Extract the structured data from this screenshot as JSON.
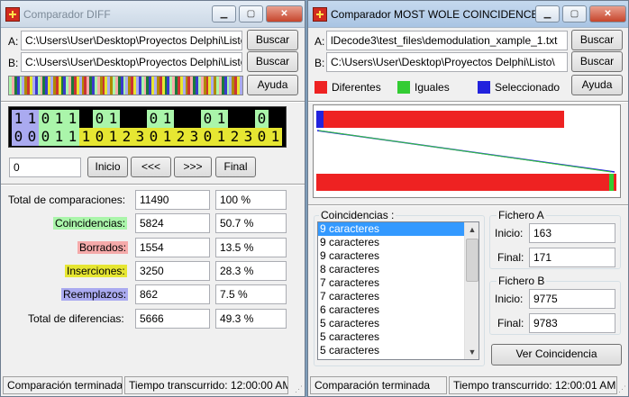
{
  "left": {
    "title": "Comparador DIFF",
    "label_a": "A:",
    "label_b": "B:",
    "path_a": "C:\\Users\\User\\Desktop\\Proyectos Delphi\\Listo",
    "path_b": "C:\\Users\\User\\Desktop\\Proyectos Delphi\\Listo",
    "buscar_a": "Buscar",
    "buscar_b": "Buscar",
    "ayuda": "Ayuda",
    "diff_row1": "11011 01  01  01  0",
    "diff_row2": "00011101230123012301",
    "position_value": "0",
    "nav": {
      "inicio": "Inicio",
      "prev": "<<<",
      "next": ">>>",
      "final": "Final"
    },
    "stats": {
      "total_label": "Total de comparaciones:",
      "total_value": "11490",
      "total_pct": "100 %",
      "coincidencias_label": "Coincidencias:",
      "coincidencias_value": "5824",
      "coincidencias_pct": "50.7 %",
      "borrados_label": "Borrados:",
      "borrados_value": "1554",
      "borrados_pct": "13.5 %",
      "inserciones_label": "Inserciones:",
      "inserciones_value": "3250",
      "inserciones_pct": "28.3 %",
      "reemplazos_label": "Reemplazos:",
      "reemplazos_value": "862",
      "reemplazos_pct": "7.5 %",
      "diferencias_label": "Total de diferencias:",
      "diferencias_value": "5666",
      "diferencias_pct": "49.3 %"
    },
    "status_left": "Comparación terminada",
    "status_right": "Tiempo transcurrido: 12:00:00 AM"
  },
  "right": {
    "title": "Comparador MOST WOLE COINCIDENCE",
    "label_a": "A:",
    "label_b": "B:",
    "path_a": "lDecode3\\test_files\\demodulation_xample_1.txt",
    "path_b": "C:\\Users\\User\\Desktop\\Proyectos Delphi\\Listo\\",
    "buscar_a": "Buscar",
    "buscar_b": "Buscar",
    "ayuda": "Ayuda",
    "legend": {
      "diferentes": "Diferentes",
      "iguales": "Iguales",
      "seleccionado": "Seleccionado"
    },
    "coincidencias_title": "Coincidencias :",
    "coincidencias_list": [
      "9 caracteres",
      "9 caracteres",
      "9 caracteres",
      "8 caracteres",
      "7 caracteres",
      "7 caracteres",
      "6 caracteres",
      "5 caracteres",
      "5 caracteres",
      "5 caracteres"
    ],
    "fichero_a": {
      "title": "Fichero A",
      "inicio_label": "Inicio:",
      "inicio_value": "163",
      "final_label": "Final:",
      "final_value": "171"
    },
    "fichero_b": {
      "title": "Fichero B",
      "inicio_label": "Inicio:",
      "inicio_value": "9775",
      "final_label": "Final:",
      "final_value": "9783"
    },
    "ver_button": "Ver Coincidencia",
    "status_left": "Comparación terminada",
    "status_right": "Tiempo transcurrido: 12:00:01 AM"
  },
  "colors": {
    "diferentes": "#ee2222",
    "iguales": "#33cc33",
    "seleccionado": "#2222dd",
    "coincidencia_hl": "#aaf5aa",
    "borrado_hl": "#f5aaaa",
    "insercion_hl": "#e6e632",
    "reemplazo_hl": "#aaaaf0"
  },
  "icons": {
    "app": "app-icon",
    "minimize": "minimize-icon",
    "maximize": "maximize-icon",
    "close": "close-icon"
  }
}
